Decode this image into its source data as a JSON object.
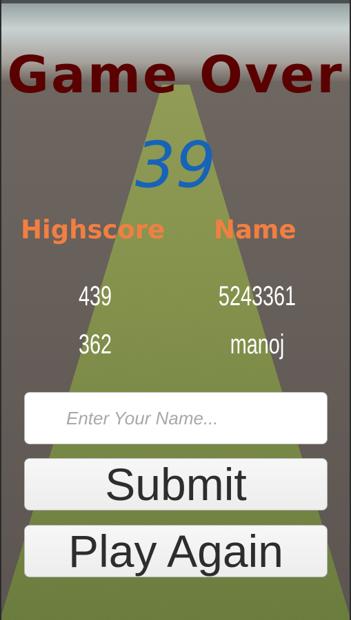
{
  "game_over": {
    "title": "Game Over",
    "score": "39",
    "table": {
      "headers": {
        "highscore": "Highscore",
        "name": "Name"
      },
      "rows": [
        {
          "score": "439",
          "name": "5243361"
        },
        {
          "score": "362",
          "name": "manoj"
        }
      ]
    },
    "name_input": {
      "value": "",
      "placeholder": "Enter Your Name..."
    },
    "submit_label": "Submit",
    "play_again_label": "Play Again"
  },
  "colors": {
    "title": "#5a0000",
    "score": "#1763b8",
    "header": "#f17f43",
    "road": "#6b7e3a",
    "background": "#6a615c"
  }
}
